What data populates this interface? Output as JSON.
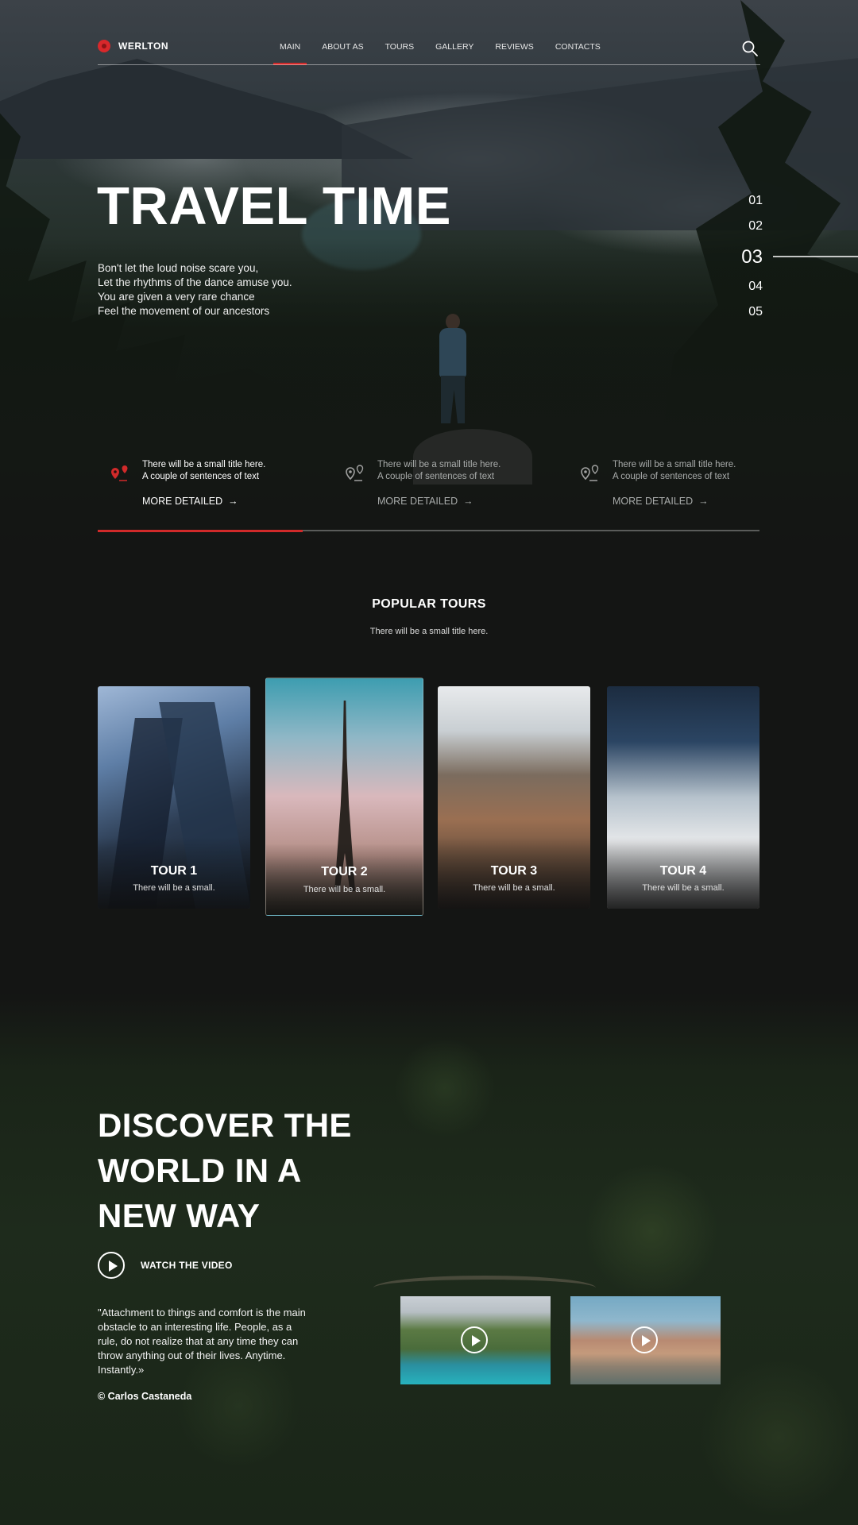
{
  "brand": {
    "name": "WERLTON",
    "accent": "#d12a2a"
  },
  "nav": {
    "items": [
      "MAIN",
      "ABOUT AS",
      "TOURS",
      "GALLERY",
      "REVIEWS",
      "CONTACTS"
    ],
    "active": "MAIN"
  },
  "hero": {
    "title": "TRAVEL TIME",
    "lines": [
      "Bon't let the loud noise scare you,",
      "Let the rhythms of the dance amuse you.",
      "You are given a very rare chance",
      "Feel the movement of our ancestors"
    ],
    "slides": [
      "01",
      "02",
      "03",
      "04",
      "05"
    ],
    "active_slide": "03",
    "progress_fraction": 0.31
  },
  "features": [
    {
      "text1": "There will be a small title here.",
      "text2": "A couple of sentences of text",
      "link": "MORE DETAILED",
      "icon": "map-pins-icon"
    },
    {
      "text1": "There will be a small title here.",
      "text2": "A couple of sentences of text",
      "link": "MORE DETAILED",
      "icon": "map-pins-icon"
    },
    {
      "text1": "There will be a small title here.",
      "text2": "A couple of sentences of text",
      "link": "MORE DETAILED",
      "icon": "map-pins-icon"
    }
  ],
  "popular": {
    "title": "POPULAR TOURS",
    "subtitle": "There will be a small title here."
  },
  "tours": [
    {
      "name": "TOUR 1",
      "sub": "There will be a small."
    },
    {
      "name": "TOUR 2",
      "sub": "There will be a small."
    },
    {
      "name": "TOUR 3",
      "sub": "There will be a small."
    },
    {
      "name": "TOUR 4",
      "sub": "There will be a small."
    }
  ],
  "discover": {
    "title_lines": [
      "DISCOVER THE",
      "WORLD IN A",
      "NEW WAY"
    ],
    "watch_label": "WATCH THE VIDEO",
    "quote_lines": [
      "\"Attachment to things and comfort is the main",
      "obstacle to an interesting life. People, as a",
      "rule, do not realize that at any time they can",
      "throw anything out of their lives. Anytime.",
      "Instantly.»"
    ],
    "author": "© Carlos Castaneda"
  }
}
